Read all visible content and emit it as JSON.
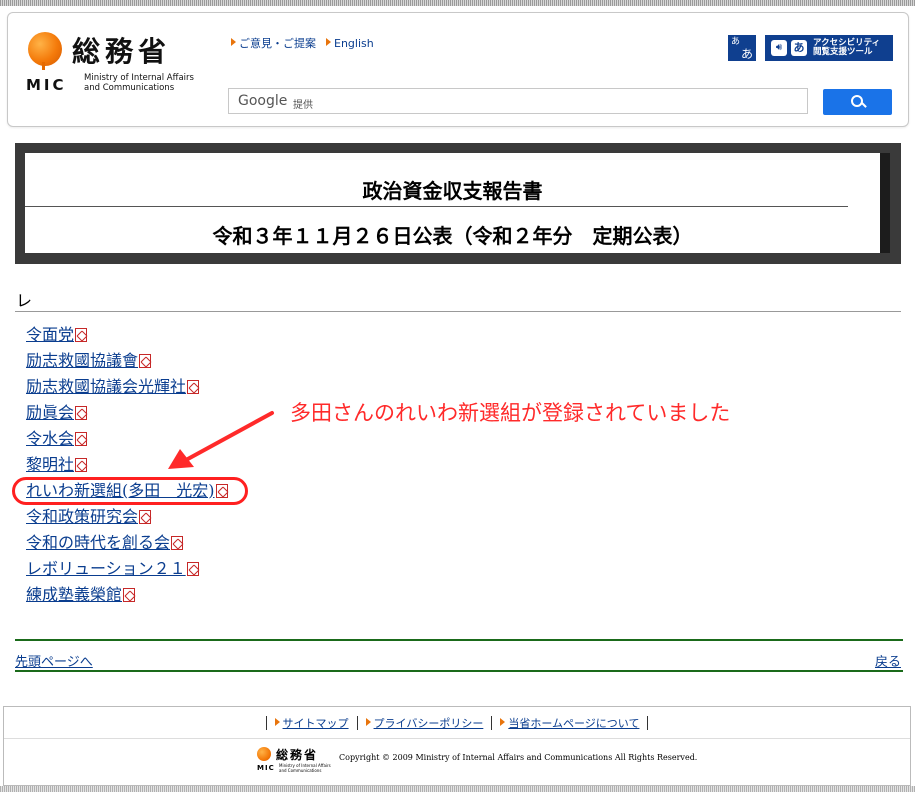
{
  "header": {
    "logo_kanji": "総務省",
    "logo_mic": "MIC",
    "logo_en_line1": "Ministry of Internal Affairs",
    "logo_en_line2": "and Communications",
    "links": [
      {
        "label": "ご意見・ご提案"
      },
      {
        "label": "English"
      }
    ],
    "furigana_btn_top": "あ",
    "furigana_btn_bottom": "あ",
    "accessibility_btn_line1": "アクセシビリティ",
    "accessibility_btn_line2": "閲覧支援ツール",
    "search": {
      "google_label": "Google",
      "provided_label": "提供",
      "value": ""
    }
  },
  "title": {
    "main": "政治資金収支報告書",
    "sub": "令和３年１１月２６日公表（令和２年分　定期公表）"
  },
  "section": {
    "heading": "レ",
    "items": [
      {
        "label": "令面党"
      },
      {
        "label": "励志救國協議會"
      },
      {
        "label": "励志救國協議会光輝社"
      },
      {
        "label": "励眞会"
      },
      {
        "label": "令水会"
      },
      {
        "label": "黎明社"
      },
      {
        "label": "れいわ新選組(多田　光宏)"
      },
      {
        "label": "令和政策研究会"
      },
      {
        "label": "令和の時代を創る会"
      },
      {
        "label": "レボリューション２１"
      },
      {
        "label": "練成塾義榮館"
      }
    ]
  },
  "annotation": {
    "text": "多田さんのれいわ新選組が登録されていました",
    "color": "#ff2a2a"
  },
  "nav": {
    "to_top": "先頭ページへ",
    "back": "戻る"
  },
  "footer": {
    "links": [
      {
        "label": "サイトマップ"
      },
      {
        "label": "プライバシーポリシー"
      },
      {
        "label": "当省ホームページについて"
      }
    ],
    "logo_kanji": "総務省",
    "logo_mic": "MIC",
    "logo_en_line1": "Ministry of Internal Affairs",
    "logo_en_line2": "and Communications",
    "copyright": "Copyright © 2009 Ministry of Internal Affairs and Communications All Rights Reserved."
  },
  "colors": {
    "link": "#0a3d8f",
    "accent_orange": "#e8740c",
    "search_button": "#1a73e8",
    "highlight": "#ff2020",
    "rule_green": "#1a6a1a"
  }
}
